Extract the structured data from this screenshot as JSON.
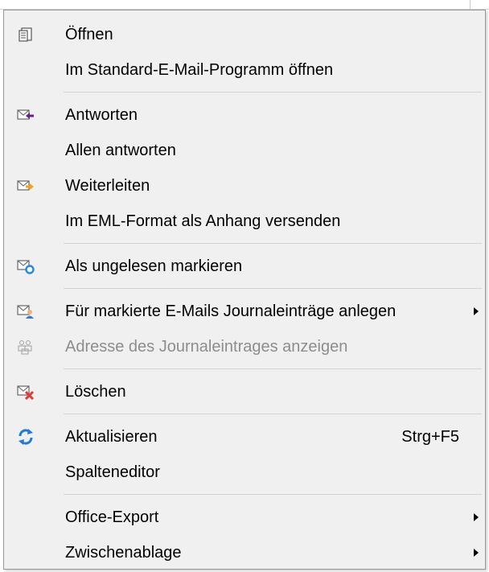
{
  "menu": {
    "items": [
      {
        "label": "Öffnen",
        "icon": "open-document-icon"
      },
      {
        "label": "Im Standard-E-Mail-Programm öffnen",
        "icon": ""
      },
      {
        "label": "Antworten",
        "icon": "reply-mail-icon"
      },
      {
        "label": "Allen antworten",
        "icon": ""
      },
      {
        "label": "Weiterleiten",
        "icon": "forward-mail-icon"
      },
      {
        "label": "Im EML-Format als Anhang versenden",
        "icon": ""
      },
      {
        "label": "Als ungelesen markieren",
        "icon": "mark-unread-icon"
      },
      {
        "label": "Für markierte E-Mails Journaleinträge anlegen",
        "icon": "journal-entry-icon"
      },
      {
        "label": "Adresse des Journaleintrages anzeigen",
        "icon": "journal-address-icon",
        "disabled": true
      },
      {
        "label": "Löschen",
        "icon": "delete-mail-icon"
      },
      {
        "label": "Aktualisieren",
        "icon": "refresh-icon",
        "shortcut": "Strg+F5"
      },
      {
        "label": "Spalteneditor",
        "icon": ""
      },
      {
        "label": "Office-Export",
        "icon": ""
      },
      {
        "label": "Zwischenablage",
        "icon": ""
      }
    ]
  },
  "colors": {
    "menu_background": "#f0f0f0",
    "border": "#979797",
    "separator": "#d4d4d4",
    "disabled_text": "#8d8d8d",
    "reply_arrow": "#6a1b9a",
    "forward_arrow": "#f7a21b",
    "unread_dot": "#1e88e5",
    "delete_x": "#e53935",
    "refresh": "#1f7ae0"
  }
}
